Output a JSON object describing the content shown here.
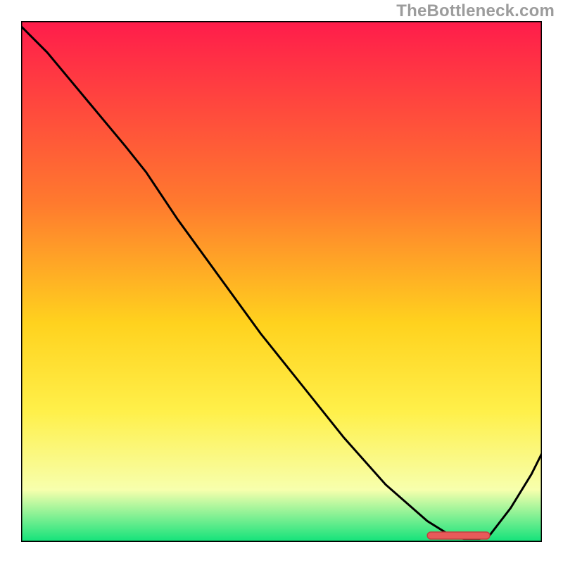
{
  "watermark": "TheBottleneck.com",
  "colors": {
    "top": "#ff1c4b",
    "mid1": "#ff7a2e",
    "mid2": "#ffd21e",
    "mid3": "#fff04a",
    "near_bot": "#f7ffad",
    "bottom": "#11e27a",
    "legend_fill": "#e85a5a",
    "legend_stroke": "#c43f3f",
    "curve": "#000000"
  },
  "chart_data": {
    "type": "line",
    "title": "",
    "xlabel": "",
    "ylabel": "",
    "xlim": [
      0,
      100
    ],
    "ylim": [
      0,
      100
    ],
    "x": [
      0,
      5,
      10,
      15,
      20,
      24,
      30,
      38,
      46,
      54,
      62,
      70,
      78,
      82,
      85,
      88,
      90,
      94,
      98,
      100
    ],
    "values": [
      99,
      94,
      88,
      82,
      76,
      71,
      62,
      51,
      40,
      30,
      20,
      11,
      4,
      1.5,
      0.6,
      0.6,
      1.3,
      6.5,
      13,
      17
    ],
    "legend_band_x": [
      78,
      90
    ],
    "annotations": []
  }
}
